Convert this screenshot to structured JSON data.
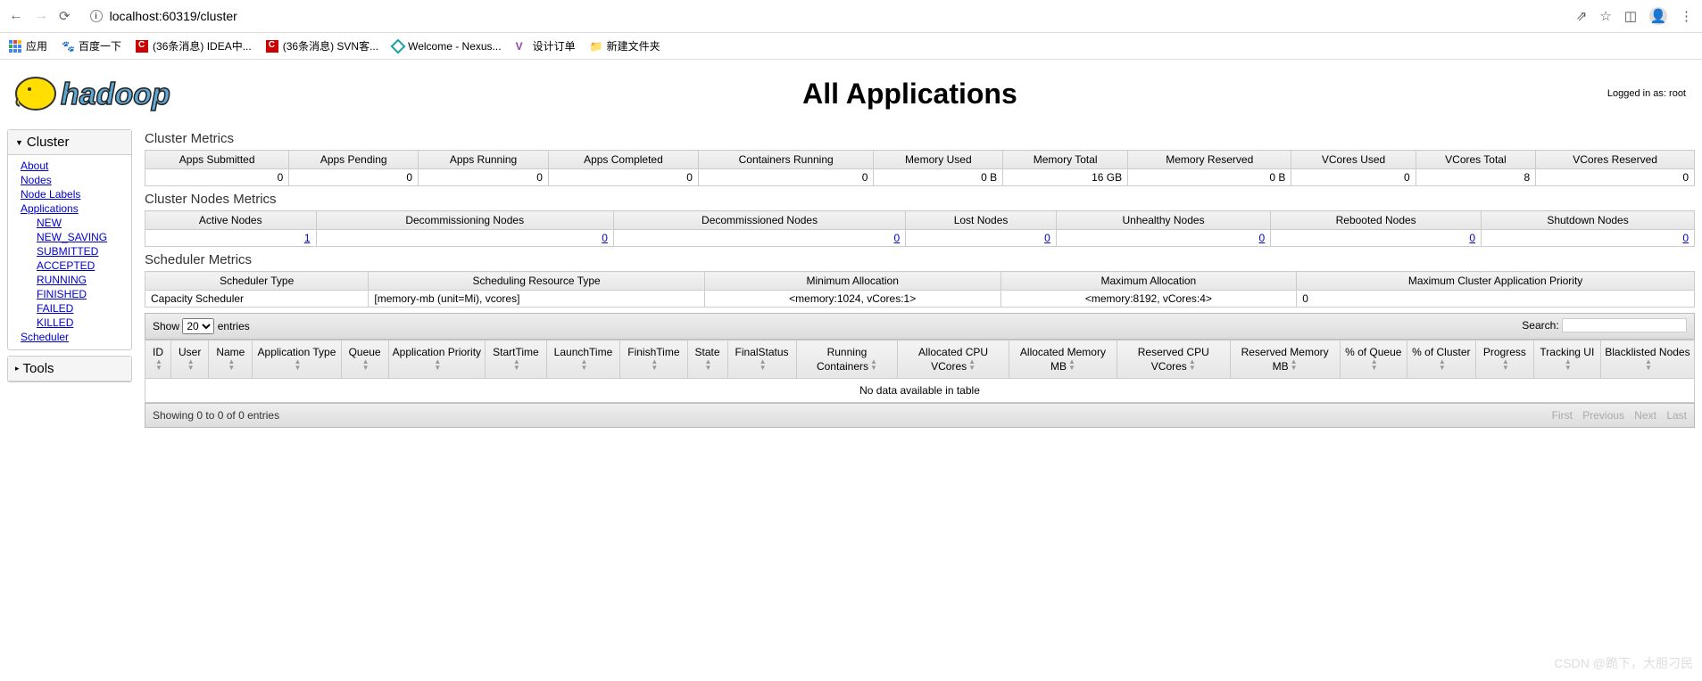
{
  "browser": {
    "url": "localhost:60319/cluster",
    "bookmarks_label": "应用",
    "bookmarks": [
      {
        "label": "百度一下"
      },
      {
        "label": "(36条消息) IDEA中..."
      },
      {
        "label": "(36条消息) SVN客..."
      },
      {
        "label": "Welcome - Nexus..."
      },
      {
        "label": "设计订单"
      },
      {
        "label": "新建文件夹"
      }
    ]
  },
  "login_text": "Logged in as: root",
  "page_title": "All Applications",
  "sidebar": {
    "cluster_label": "Cluster",
    "tools_label": "Tools",
    "links": {
      "about": "About",
      "nodes": "Nodes",
      "node_labels": "Node Labels",
      "applications": "Applications",
      "scheduler": "Scheduler"
    },
    "app_states": [
      "NEW",
      "NEW_SAVING",
      "SUBMITTED",
      "ACCEPTED",
      "RUNNING",
      "FINISHED",
      "FAILED",
      "KILLED"
    ]
  },
  "cluster_metrics": {
    "title": "Cluster Metrics",
    "headers": [
      "Apps Submitted",
      "Apps Pending",
      "Apps Running",
      "Apps Completed",
      "Containers Running",
      "Memory Used",
      "Memory Total",
      "Memory Reserved",
      "VCores Used",
      "VCores Total",
      "VCores Reserved"
    ],
    "values": [
      "0",
      "0",
      "0",
      "0",
      "0",
      "0 B",
      "16 GB",
      "0 B",
      "0",
      "8",
      "0"
    ]
  },
  "nodes_metrics": {
    "title": "Cluster Nodes Metrics",
    "headers": [
      "Active Nodes",
      "Decommissioning Nodes",
      "Decommissioned Nodes",
      "Lost Nodes",
      "Unhealthy Nodes",
      "Rebooted Nodes",
      "Shutdown Nodes"
    ],
    "values": [
      "1",
      "0",
      "0",
      "0",
      "0",
      "0",
      "0"
    ]
  },
  "scheduler_metrics": {
    "title": "Scheduler Metrics",
    "headers": [
      "Scheduler Type",
      "Scheduling Resource Type",
      "Minimum Allocation",
      "Maximum Allocation",
      "Maximum Cluster Application Priority"
    ],
    "values": [
      "Capacity Scheduler",
      "[memory-mb (unit=Mi), vcores]",
      "<memory:1024, vCores:1>",
      "<memory:8192, vCores:4>",
      "0"
    ]
  },
  "apps_table": {
    "show_label": "Show",
    "entries_label": "entries",
    "entries_value": "20",
    "search_label": "Search:",
    "headers": [
      "ID",
      "User",
      "Name",
      "Application Type",
      "Queue",
      "Application Priority",
      "StartTime",
      "LaunchTime",
      "FinishTime",
      "State",
      "FinalStatus",
      "Running Containers",
      "Allocated CPU VCores",
      "Allocated Memory MB",
      "Reserved CPU VCores",
      "Reserved Memory MB",
      "% of Queue",
      "% of Cluster",
      "Progress",
      "Tracking UI",
      "Blacklisted Nodes"
    ],
    "no_data": "No data available in table",
    "info": "Showing 0 to 0 of 0 entries",
    "pager": {
      "first": "First",
      "prev": "Previous",
      "next": "Next",
      "last": "Last"
    }
  },
  "watermark": "CSDN @跪下，大胆刁民"
}
